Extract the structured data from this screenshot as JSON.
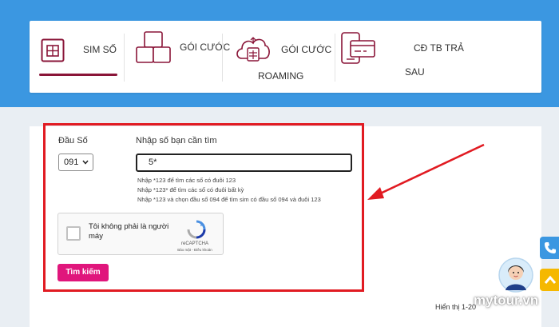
{
  "nav": {
    "tabs": [
      {
        "label": "SIM SỐ",
        "icon": "sim-card-icon"
      },
      {
        "label": "GÓI CƯỚC",
        "icon": "stacked-boxes-icon"
      },
      {
        "label_line1": "GÓI CƯỚC",
        "label_line2": "ROAMING",
        "icon": "cloud-sim-icon"
      },
      {
        "label_line1": "CĐ TB TRẢ",
        "label_line2": "SAU",
        "icon": "sim-device-icon"
      }
    ],
    "active_color": "#8a1538"
  },
  "form": {
    "prefix_label": "Đầu Số",
    "prefix_value": "091",
    "search_label": "Nhập số bạn cần tìm",
    "search_value": "5*",
    "hints": [
      "Nhập *123 để tìm các số có đuôi 123",
      "Nhập *123* để tìm các số có đuôi bất kỳ",
      "Nhập *123 và chọn đầu số 094 để tìm sim có đầu số 094 và đuôi 123"
    ],
    "captcha": {
      "text": "Tôi không phải là người máy",
      "brand": "reCAPTCHA",
      "links": "Bảo mật - Điều khoản"
    },
    "search_button": "Tìm kiếm"
  },
  "results_text": "Hiển thị 1-20",
  "watermark": "mytour.vn",
  "colors": {
    "top_band": "#3b97e1",
    "button": "#e0167c",
    "highlight_box": "#e11b22",
    "arrow": "#e11b22"
  }
}
